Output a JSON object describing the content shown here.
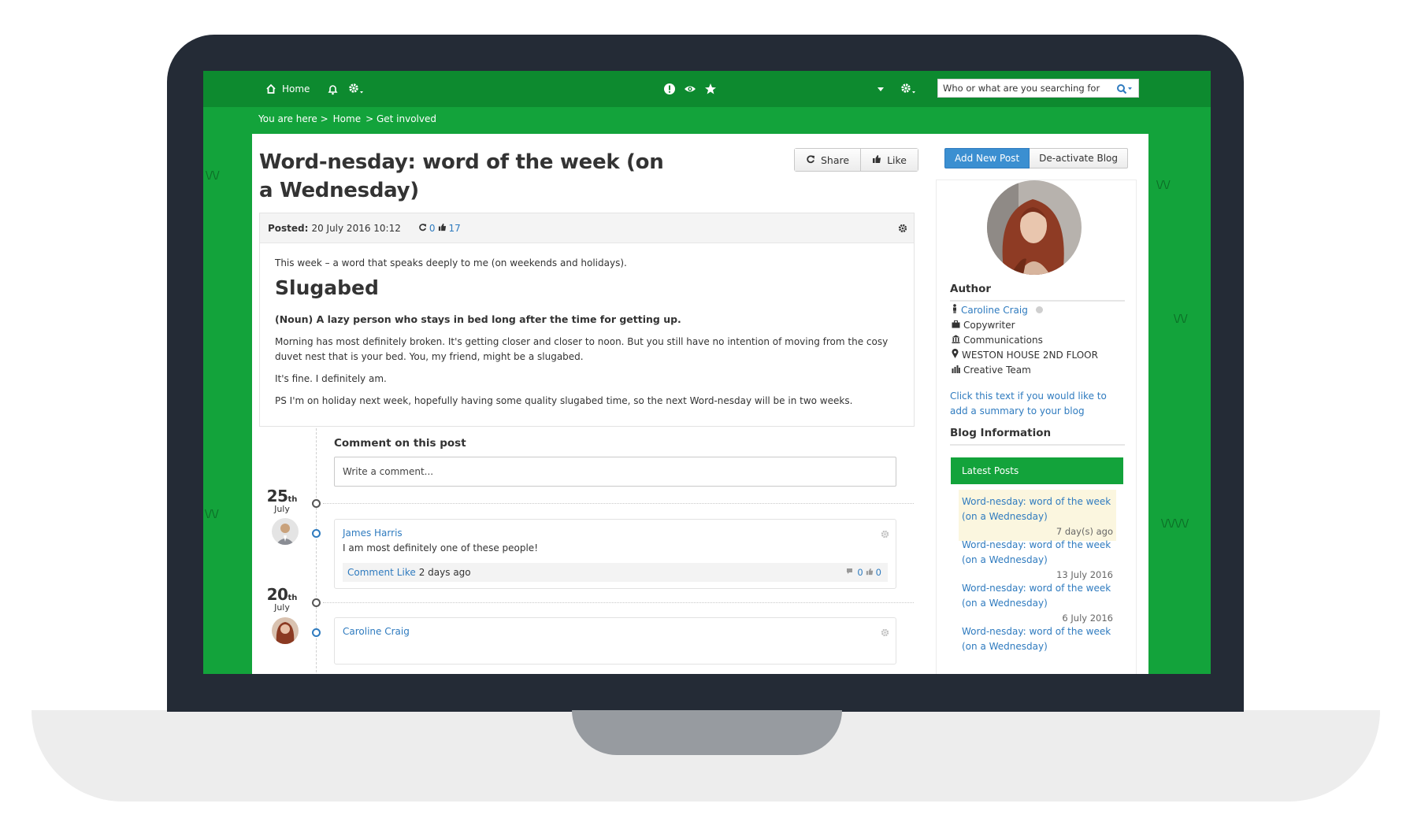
{
  "nav": {
    "home_label": "Home",
    "search_placeholder": "Who or what are you searching for"
  },
  "breadcrumb": {
    "prefix": "You are here >",
    "items": [
      "Home",
      "> Get involved"
    ]
  },
  "post": {
    "title": "Word-nesday: word of the week (on a Wednesday)",
    "share_label": "Share",
    "like_label": "Like",
    "posted_label": "Posted:",
    "posted_date": "20 July 2016 10:12",
    "share_count": "0",
    "like_count": "17",
    "intro": "This week – a word that speaks deeply to me (on weekends and holidays).",
    "word": "Slugabed",
    "definition": "(Noun) A lazy person who stays in bed long after the time for getting up.",
    "paragraphs": [
      "Morning has most definitely broken. It's getting closer and closer to noon. But you still have no intention of moving from the cosy duvet nest that is your bed. You, my friend, might be a slugabed.",
      "It's fine. I definitely am.",
      "PS I'm on holiday next week, hopefully having some quality slugabed time, so the next Word-nesday will be in two weeks."
    ]
  },
  "comments": {
    "heading": "Comment on this post",
    "input_placeholder": "Write a comment...",
    "groups": [
      {
        "day": "25",
        "suffix": "th",
        "month": "July",
        "author": "James Harris",
        "text": "I am most definitely one of these people!",
        "action_comment": "Comment",
        "action_like": "Like",
        "when": "2 days ago",
        "comment_count": "0",
        "like_count": "0"
      },
      {
        "day": "20",
        "suffix": "th",
        "month": "July",
        "author": "Caroline Craig"
      }
    ]
  },
  "sidebar": {
    "add_post_label": "Add New Post",
    "deactivate_label": "De-activate Blog",
    "author_heading": "Author",
    "author_name": "Caroline Craig",
    "job_title": "Copywriter",
    "department": "Communications",
    "location": "WESTON HOUSE 2ND FLOOR",
    "team": "Creative Team",
    "summary_prompt": "Click this text if you would like to add a summary to your blog",
    "blog_info_heading": "Blog Information",
    "latest_posts_heading": "Latest Posts",
    "latest_posts": [
      {
        "title": "Word-nesday: word of the week (on a Wednesday)",
        "time": "7 day(s) ago"
      },
      {
        "title": "Word-nesday: word of the week (on a Wednesday)",
        "time": "13 July 2016"
      },
      {
        "title": "Word-nesday: word of the week (on a Wednesday)",
        "time": "6 July 2016"
      },
      {
        "title": "Word-nesday: word of the week (on a Wednesday)",
        "time": ""
      }
    ]
  },
  "colors": {
    "brand_green": "#13a33b",
    "nav_green": "#0d8a2f",
    "link_blue": "#2f7bbf",
    "primary_button": "#3b8fd1",
    "laptop_frame": "#242b36"
  }
}
